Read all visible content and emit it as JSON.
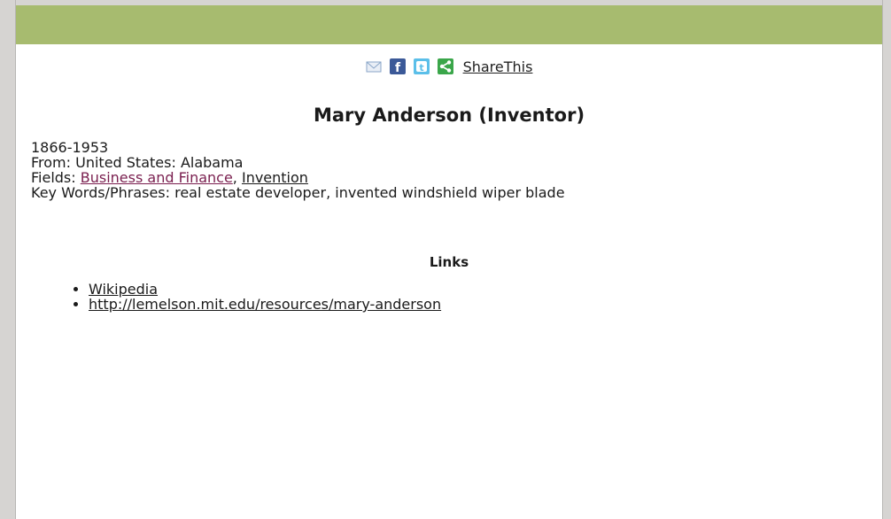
{
  "share": {
    "icons": [
      "email-icon",
      "facebook-icon",
      "twitter-icon",
      "share-icon"
    ],
    "label": "ShareThis"
  },
  "colors": {
    "header_bar": "#a7bb6f",
    "email": "#8aa6c8",
    "facebook": "#3b5998",
    "twitter": "#5bbfe9",
    "share": "#3aa64a",
    "visited_link": "#7a1f4f"
  },
  "profile": {
    "name": "Mary Anderson (Inventor)",
    "years": "1866-1953",
    "from": "From: United States: Alabama",
    "fields_prefix": "Fields: ",
    "fields": [
      "Business and Finance",
      "Invention"
    ],
    "fields_separator": ", ",
    "keywords": "Key Words/Phrases: real estate developer, invented windshield wiper blade"
  },
  "links": {
    "heading": "Links",
    "items": [
      "Wikipedia",
      "http://lemelson.mit.edu/resources/mary-anderson"
    ]
  }
}
